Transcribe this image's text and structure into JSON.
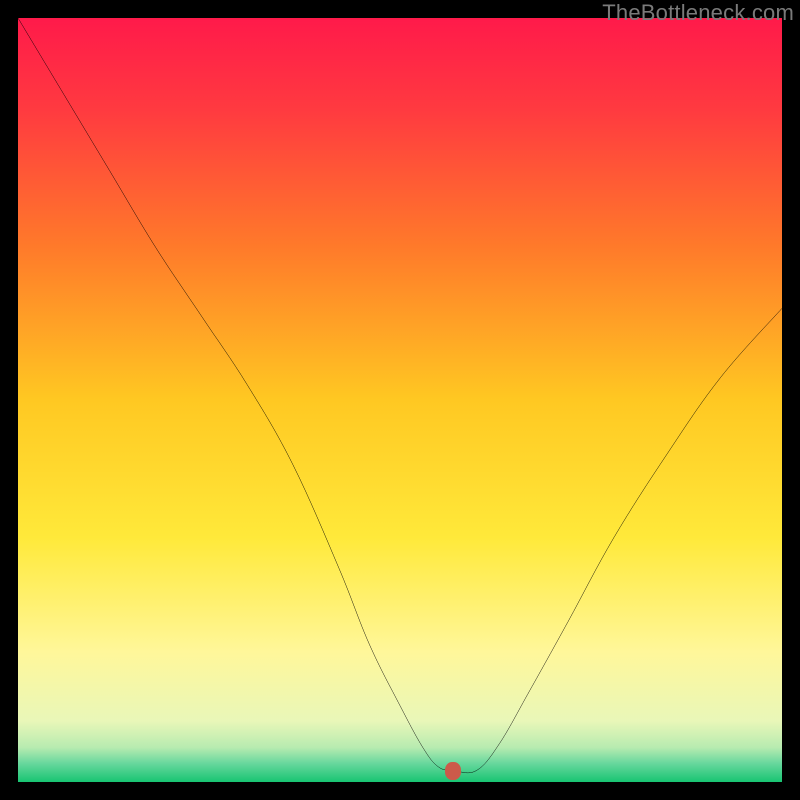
{
  "watermark": {
    "text": "TheBottleneck.com"
  },
  "colors": {
    "black": "#000000",
    "curve": "#000000",
    "marker": "#cc5a4a",
    "watermark": "#7a7a7a",
    "grad_stops": [
      {
        "offset": 0.0,
        "hex": "#ff1a4a"
      },
      {
        "offset": 0.12,
        "hex": "#ff3a40"
      },
      {
        "offset": 0.3,
        "hex": "#ff7a2a"
      },
      {
        "offset": 0.5,
        "hex": "#ffc822"
      },
      {
        "offset": 0.68,
        "hex": "#ffe93a"
      },
      {
        "offset": 0.83,
        "hex": "#fff79a"
      },
      {
        "offset": 0.92,
        "hex": "#e9f7b8"
      },
      {
        "offset": 0.955,
        "hex": "#b7ebb0"
      },
      {
        "offset": 0.975,
        "hex": "#6ad89e"
      },
      {
        "offset": 1.0,
        "hex": "#18c572"
      }
    ]
  },
  "chart_data": {
    "type": "line",
    "title": "",
    "xlabel": "",
    "ylabel": "",
    "xlim": [
      0,
      100
    ],
    "ylim": [
      0,
      100
    ],
    "grid": false,
    "legend": false,
    "series": [
      {
        "name": "bottleneck-curve",
        "x": [
          0,
          6,
          12,
          18,
          24,
          30,
          36,
          42,
          46,
          50,
          53,
          55,
          57,
          60,
          63,
          67,
          72,
          78,
          85,
          92,
          100
        ],
        "y": [
          100,
          90,
          80,
          70,
          61,
          52,
          41.5,
          28,
          18,
          10,
          4.5,
          2,
          1.5,
          1.5,
          5,
          12,
          21,
          32,
          43,
          53,
          62
        ]
      }
    ],
    "marker": {
      "x": 57,
      "y": 1.5
    }
  }
}
